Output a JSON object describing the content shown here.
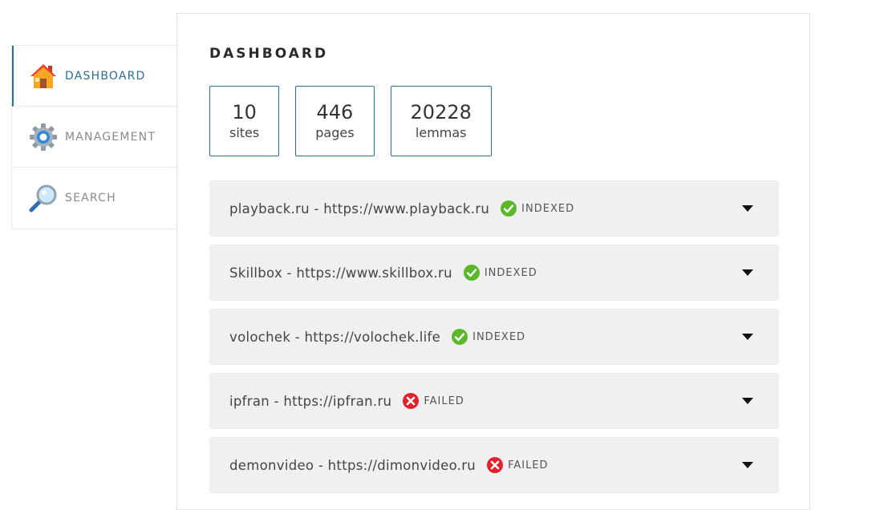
{
  "nav": {
    "items": [
      {
        "label": "DASHBOARD",
        "icon": "home-icon",
        "active": true
      },
      {
        "label": "MANAGEMENT",
        "icon": "gear-icon",
        "active": false
      },
      {
        "label": "SEARCH",
        "icon": "magnifier-icon",
        "active": false
      }
    ]
  },
  "main": {
    "title": "DASHBOARD",
    "stats": [
      {
        "value": "10",
        "label": "sites"
      },
      {
        "value": "446",
        "label": "pages"
      },
      {
        "value": "20228",
        "label": "lemmas"
      }
    ],
    "sites": [
      {
        "title": "playback.ru - https://www.playback.ru",
        "status": "INDEXED",
        "status_icon": "check-circle-icon"
      },
      {
        "title": "Skillbox - https://www.skillbox.ru",
        "status": "INDEXED",
        "status_icon": "check-circle-icon"
      },
      {
        "title": "volochek - https://volochek.life",
        "status": "INDEXED",
        "status_icon": "check-circle-icon"
      },
      {
        "title": "ipfran - https://ipfran.ru",
        "status": "FAILED",
        "status_icon": "x-circle-icon"
      },
      {
        "title": "demonvideo - https://dimonvideo.ru",
        "status": "FAILED",
        "status_icon": "x-circle-icon"
      }
    ]
  },
  "colors": {
    "accent": "#2a6f97",
    "row_bg": "#f0f0f0",
    "indexed": "#5cb82a",
    "failed": "#e2212b"
  }
}
